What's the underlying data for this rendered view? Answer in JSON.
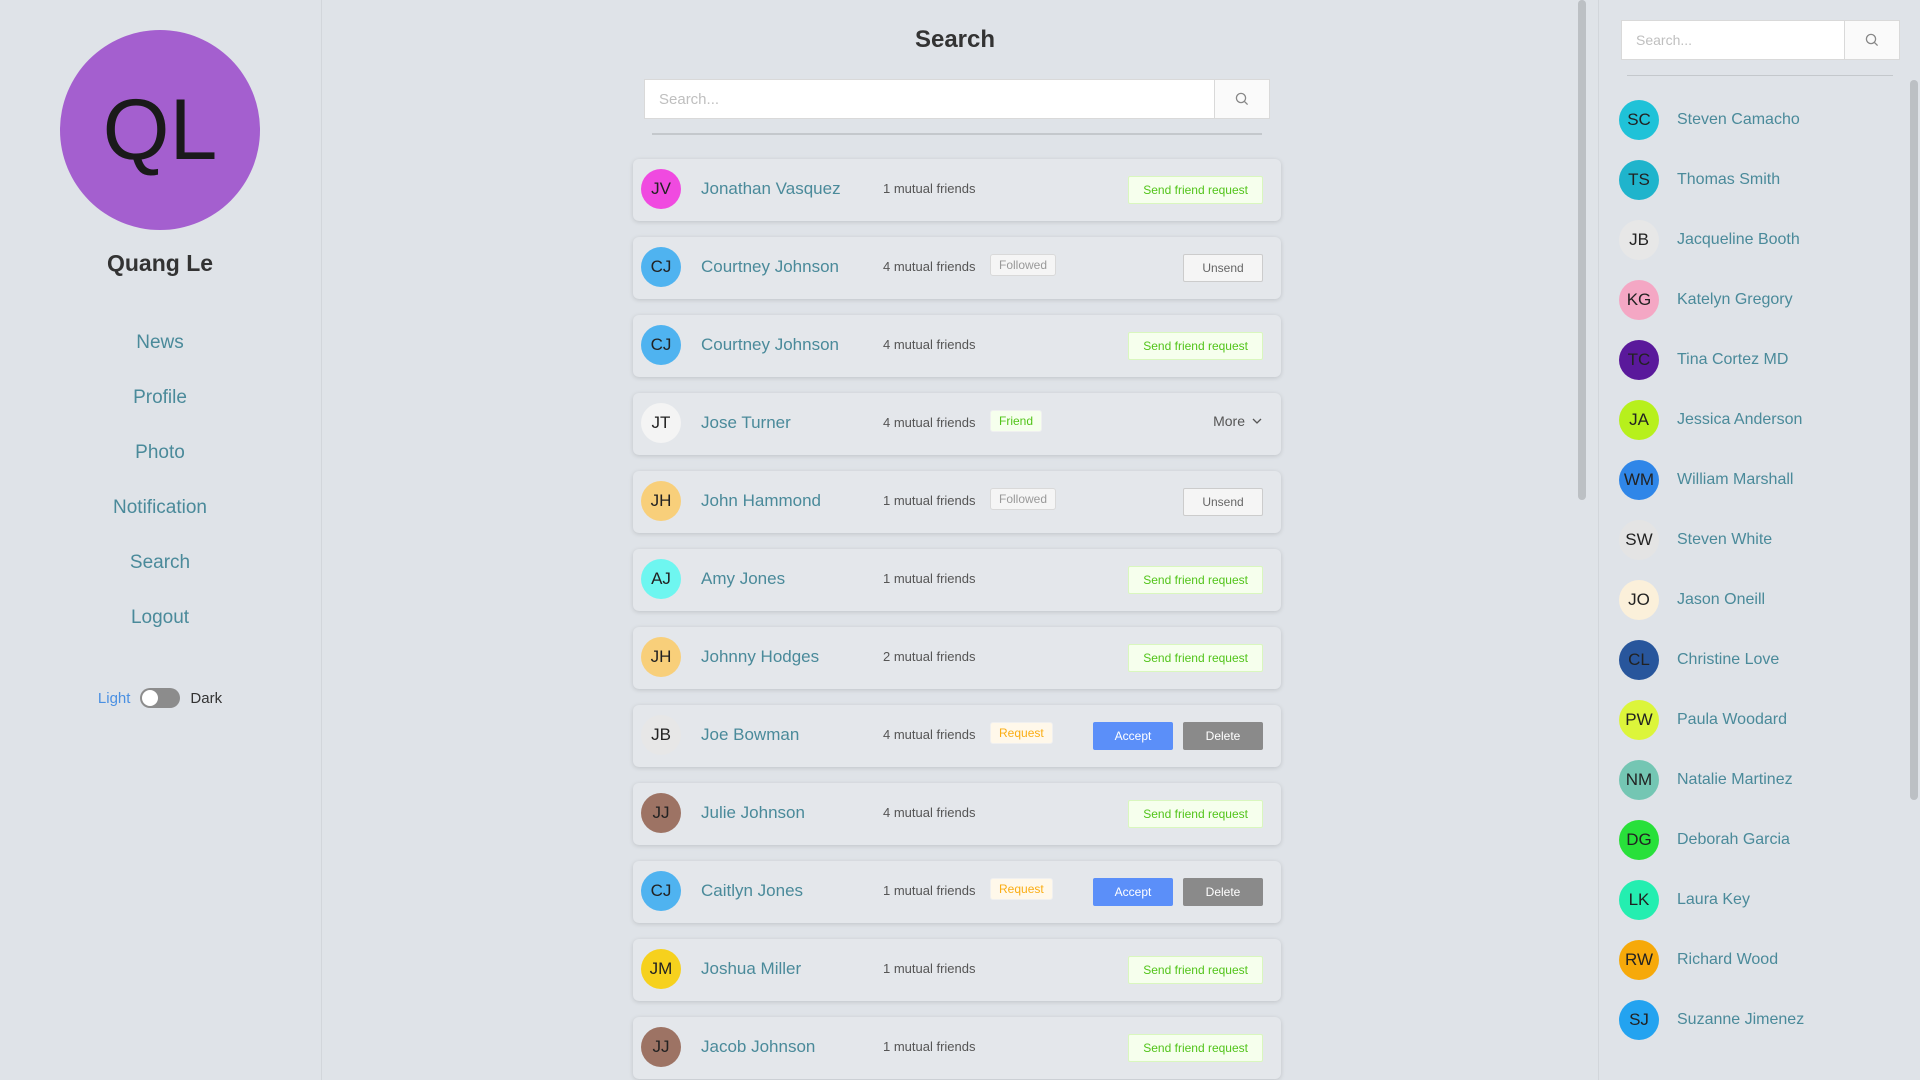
{
  "profile": {
    "initials": "QL",
    "name": "Quang Le",
    "avatar_color": "#a45fcf"
  },
  "nav": [
    {
      "label": "News",
      "key": "news"
    },
    {
      "label": "Profile",
      "key": "profile"
    },
    {
      "label": "Photo",
      "key": "photo"
    },
    {
      "label": "Notification",
      "key": "notification"
    },
    {
      "label": "Search",
      "key": "search"
    },
    {
      "label": "Logout",
      "key": "logout"
    }
  ],
  "theme": {
    "light_label": "Light",
    "dark_label": "Dark",
    "mode": "light"
  },
  "main": {
    "title": "Search",
    "search_placeholder": "Search..."
  },
  "results": [
    {
      "initials": "JV",
      "name": "Jonathan Vasquez",
      "mutual": "1 mutual friends",
      "color": "#f04ae0",
      "status": "",
      "action": "send",
      "action_label": "Send friend request"
    },
    {
      "initials": "CJ",
      "name": "Courtney Johnson",
      "mutual": "4 mutual friends",
      "color": "#4fb3f0",
      "status": "Followed",
      "action": "unsend",
      "action_label": "Unsend"
    },
    {
      "initials": "CJ",
      "name": "Courtney Johnson",
      "mutual": "4 mutual friends",
      "color": "#4fb3f0",
      "status": "",
      "action": "send",
      "action_label": "Send friend request"
    },
    {
      "initials": "JT",
      "name": "Jose Turner",
      "mutual": "4 mutual friends",
      "color": "#f4f4f4",
      "status": "Friend",
      "action": "more",
      "action_label": "More"
    },
    {
      "initials": "JH",
      "name": "John Hammond",
      "mutual": "1 mutual friends",
      "color": "#f8cf7a",
      "status": "Followed",
      "action": "unsend",
      "action_label": "Unsend"
    },
    {
      "initials": "AJ",
      "name": "Amy Jones",
      "mutual": "1 mutual friends",
      "color": "#6ef6f0",
      "status": "",
      "action": "send",
      "action_label": "Send friend request"
    },
    {
      "initials": "JH",
      "name": "Johnny Hodges",
      "mutual": "2 mutual friends",
      "color": "#f8cf7a",
      "status": "",
      "action": "send",
      "action_label": "Send friend request"
    },
    {
      "initials": "JB",
      "name": "Joe Bowman",
      "mutual": "4 mutual friends",
      "color": "#e7e7e7",
      "status": "Request",
      "action": "accept",
      "accept_label": "Accept",
      "delete_label": "Delete"
    },
    {
      "initials": "JJ",
      "name": "Julie Johnson",
      "mutual": "4 mutual friends",
      "color": "#9d7364",
      "status": "",
      "action": "send",
      "action_label": "Send friend request"
    },
    {
      "initials": "CJ",
      "name": "Caitlyn Jones",
      "mutual": "1 mutual friends",
      "color": "#4fb3f0",
      "status": "Request",
      "action": "accept",
      "accept_label": "Accept",
      "delete_label": "Delete"
    },
    {
      "initials": "JM",
      "name": "Joshua Miller",
      "mutual": "1 mutual friends",
      "color": "#f6d11d",
      "status": "",
      "action": "send",
      "action_label": "Send friend request"
    },
    {
      "initials": "JJ",
      "name": "Jacob Johnson",
      "mutual": "1 mutual friends",
      "color": "#9d7364",
      "status": "",
      "action": "send",
      "action_label": "Send friend request"
    }
  ],
  "sidebar_right": {
    "search_placeholder": "Search...",
    "contacts": [
      {
        "initials": "SC",
        "name": "Steven Camacho",
        "color": "#1fc2d8"
      },
      {
        "initials": "TS",
        "name": "Thomas Smith",
        "color": "#1fb4cc"
      },
      {
        "initials": "JB",
        "name": "Jacqueline Booth",
        "color": "#e7e7e7"
      },
      {
        "initials": "KG",
        "name": "Katelyn Gregory",
        "color": "#f4a7c4"
      },
      {
        "initials": "TC",
        "name": "Tina Cortez MD",
        "color": "#5a199b"
      },
      {
        "initials": "JA",
        "name": "Jessica Anderson",
        "color": "#b7f01c"
      },
      {
        "initials": "WM",
        "name": "William Marshall",
        "color": "#2f86e8"
      },
      {
        "initials": "SW",
        "name": "Steven White",
        "color": "#e4e4e4"
      },
      {
        "initials": "JO",
        "name": "Jason Oneill",
        "color": "#fbf0da"
      },
      {
        "initials": "CL",
        "name": "Christine Love",
        "color": "#28569c"
      },
      {
        "initials": "PW",
        "name": "Paula Woodard",
        "color": "#dcf53a"
      },
      {
        "initials": "NM",
        "name": "Natalie Martinez",
        "color": "#74c6b3"
      },
      {
        "initials": "DG",
        "name": "Deborah Garcia",
        "color": "#28e03a"
      },
      {
        "initials": "LK",
        "name": "Laura Key",
        "color": "#24eeb0"
      },
      {
        "initials": "RW",
        "name": "Richard Wood",
        "color": "#f6a90a"
      },
      {
        "initials": "SJ",
        "name": "Suzanne Jimenez",
        "color": "#23a3f0"
      }
    ]
  }
}
